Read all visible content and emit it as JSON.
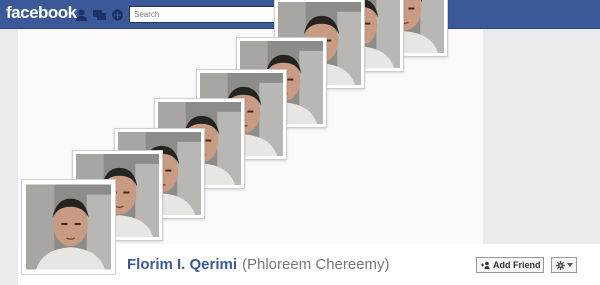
{
  "topbar": {
    "logo": "facebook",
    "search": {
      "placeholder": "Search"
    }
  },
  "profile": {
    "name": "Florim I. Qerimi",
    "alternate_name": "(Phloreem Chereemy)",
    "add_friend_label": "Add Friend"
  },
  "colors": {
    "brand": "#3b5998",
    "cover_background": "#fcf9fa",
    "page_background": "#e9ebee"
  }
}
